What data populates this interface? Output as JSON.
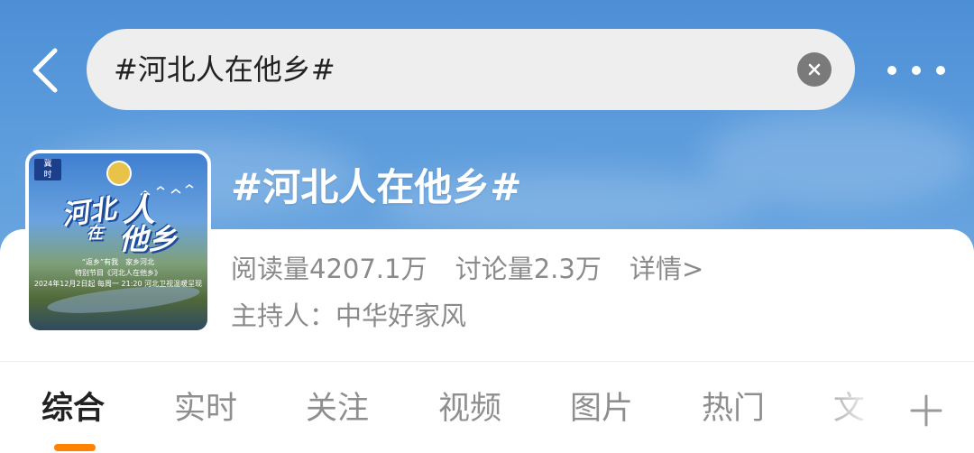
{
  "header": {
    "search_query": "#河北人在他乡#",
    "back_icon": "chevron-left-icon",
    "clear_icon": "close-icon",
    "more_icon": "more-horizontal-icon"
  },
  "topic": {
    "title": "#河北人在他乡#",
    "read_count": "阅读量4207.1万",
    "discussion_count": "讨论量2.3万",
    "detail_link": "详情>",
    "host": "主持人：中华好家风"
  },
  "tabs": [
    {
      "label": "综合",
      "active": true
    },
    {
      "label": "实时",
      "active": false
    },
    {
      "label": "关注",
      "active": false
    },
    {
      "label": "视频",
      "active": false
    },
    {
      "label": "图片",
      "active": false
    },
    {
      "label": "热门",
      "active": false
    },
    {
      "label": "文",
      "active": false
    }
  ],
  "add_tab_icon": "plus-icon",
  "colors": {
    "header_blue": "#5b9bdc",
    "active_tab_indicator": "#ff8200",
    "secondary_text": "#8a8a8a",
    "search_background": "#eeeeee"
  }
}
